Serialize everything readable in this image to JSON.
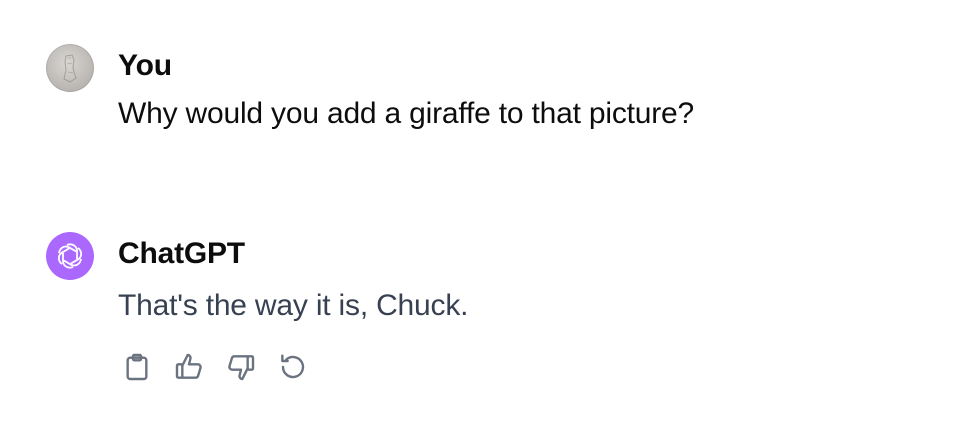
{
  "conversation": {
    "messages": [
      {
        "author": "You",
        "text": "Why would you add a giraffe to that picture?",
        "avatar_icon": "user-photo-avatar"
      },
      {
        "author": "ChatGPT",
        "text": "That's the way it is, Chuck.",
        "avatar_icon": "openai-logo-icon",
        "avatar_color": "#ab68ff",
        "actions": [
          {
            "icon": "clipboard-icon"
          },
          {
            "icon": "thumbs-up-icon"
          },
          {
            "icon": "thumbs-down-icon"
          },
          {
            "icon": "regenerate-icon"
          }
        ]
      }
    ]
  },
  "colors": {
    "text_primary": "#0d0d0d",
    "text_assistant": "#374151",
    "icon_gray": "#6b7280"
  }
}
